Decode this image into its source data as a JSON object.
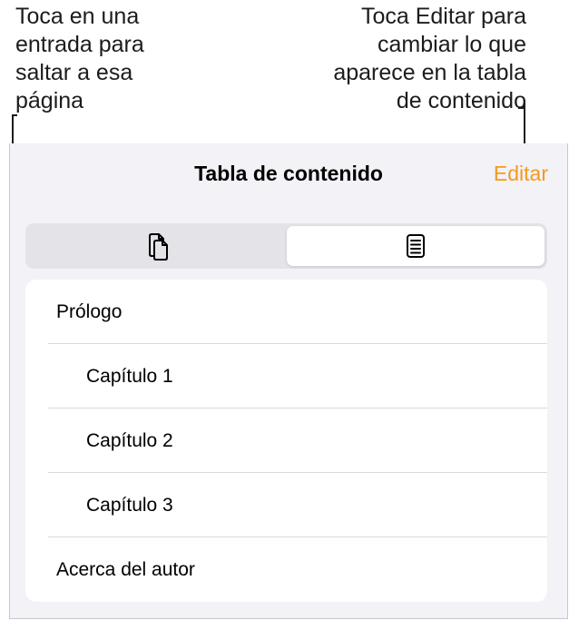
{
  "callouts": {
    "left": [
      "Toca en una",
      "entrada para",
      "saltar a esa",
      "página"
    ],
    "right": [
      "Toca Editar para",
      "cambiar lo que",
      "aparece en la tabla",
      "de contenido"
    ]
  },
  "header": {
    "title": "Tabla de contenido",
    "edit_label": "Editar"
  },
  "segmented": {
    "segments": [
      {
        "icon": "page-thumbnails-icon",
        "selected": false
      },
      {
        "icon": "table-of-contents-icon",
        "selected": true
      }
    ]
  },
  "toc": {
    "items": [
      {
        "label": "Prólogo",
        "level": 0
      },
      {
        "label": "Capítulo 1",
        "level": 1
      },
      {
        "label": "Capítulo 2",
        "level": 1
      },
      {
        "label": "Capítulo 3",
        "level": 1
      },
      {
        "label": "Acerca del autor",
        "level": 0
      }
    ]
  },
  "colors": {
    "accent": "#f39a1f",
    "panel_background": "#f2f2f7",
    "segmented_track": "#e3e3e8"
  }
}
